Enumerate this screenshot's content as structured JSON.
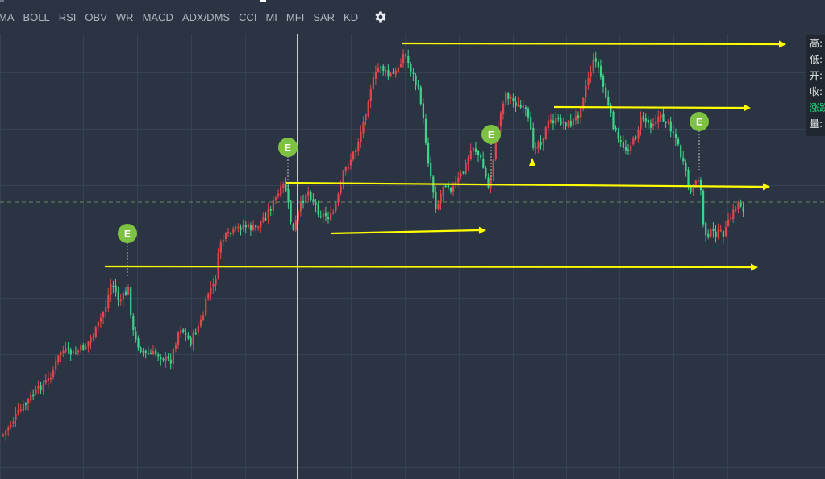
{
  "toolbar": {
    "tabs": [
      "MA",
      "BOLL",
      "RSI",
      "OBV",
      "WR",
      "MACD",
      "ADX/DMS",
      "CCI",
      "MI",
      "MFI",
      "SAR",
      "KD"
    ],
    "settings_icon": "gear-icon"
  },
  "info_panel": {
    "rows": [
      "高:",
      "低:",
      "开:",
      "收:",
      "涨跌",
      "量:"
    ]
  },
  "colors": {
    "background": "#2b3443",
    "grid": "#364153",
    "up": "#e0474c",
    "down": "#3fd28a",
    "annotation": "#ffff00",
    "marker": "#7dc242",
    "crosshair": "#c8ccd2",
    "price_line": "#6f8a5c"
  },
  "chart_data": {
    "type": "candlestick",
    "title": "",
    "x_axis": "none shown",
    "y_axis": "none shown",
    "grid": true,
    "markers": [
      {
        "label": "E"
      },
      {
        "label": "E"
      },
      {
        "label": "E"
      },
      {
        "label": "E"
      }
    ],
    "annotations": [
      {
        "kind": "arrow",
        "color": "yellow"
      },
      {
        "kind": "arrow",
        "color": "yellow"
      },
      {
        "kind": "arrow",
        "color": "yellow"
      },
      {
        "kind": "arrow",
        "color": "yellow"
      },
      {
        "kind": "arrow",
        "color": "yellow"
      },
      {
        "kind": "arrow",
        "color": "yellow"
      }
    ]
  }
}
